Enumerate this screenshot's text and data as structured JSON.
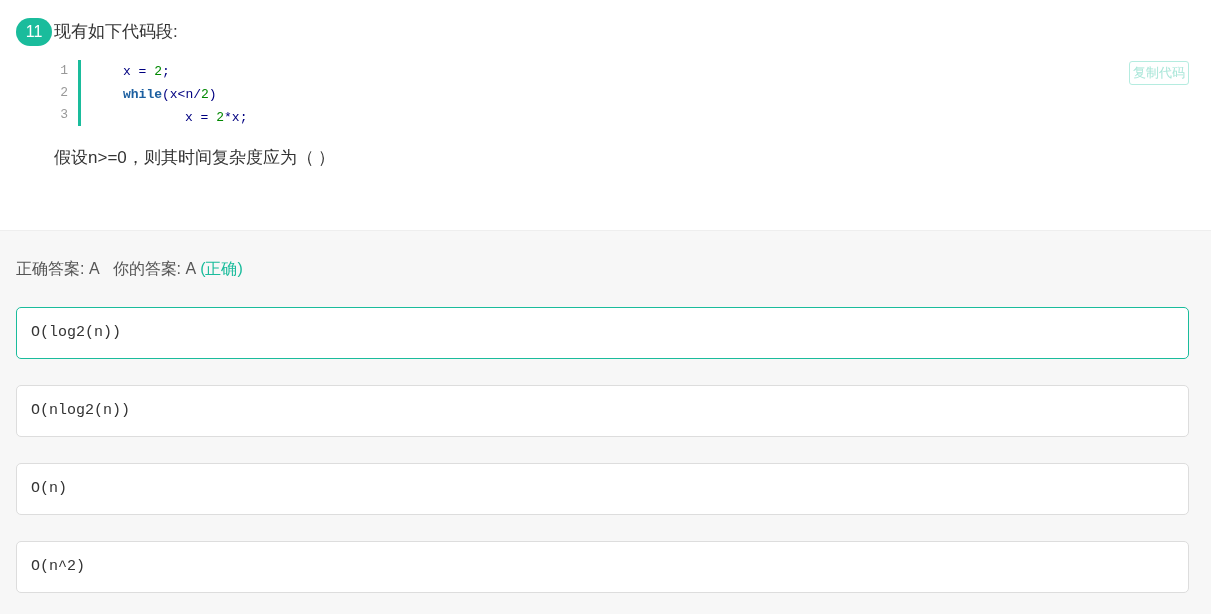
{
  "question": {
    "number": "11",
    "title": "现有如下代码段:",
    "code_lines": [
      {
        "number": "1",
        "tokens": [
          {
            "kind": "plain",
            "text": "x = "
          },
          {
            "kind": "number",
            "text": "2"
          },
          {
            "kind": "plain",
            "text": ";"
          }
        ]
      },
      {
        "number": "2",
        "tokens": [
          {
            "kind": "keyword",
            "text": "while"
          },
          {
            "kind": "plain",
            "text": "(x<n/"
          },
          {
            "kind": "number",
            "text": "2"
          },
          {
            "kind": "plain",
            "text": ")"
          }
        ],
        "children": [
          {
            "number": "3",
            "tokens": [
              {
                "kind": "plain",
                "text": "x = "
              },
              {
                "kind": "number",
                "text": "2"
              },
              {
                "kind": "plain",
                "text": "*x;"
              }
            ]
          }
        ]
      }
    ],
    "copy_button": "复制代码",
    "prompt": "假设n>=0，则其时间复杂度应为（   ）"
  },
  "result": {
    "correct_answer": "正确答案: A",
    "your_answer": "你的答案: A",
    "verdict": "(正确)"
  },
  "options": [
    {
      "text": "O(log2(n))",
      "selected": true
    },
    {
      "text": "O(nlog2(n))",
      "selected": false
    },
    {
      "text": "O(n)",
      "selected": false
    },
    {
      "text": "O(n^2)",
      "selected": false
    }
  ]
}
